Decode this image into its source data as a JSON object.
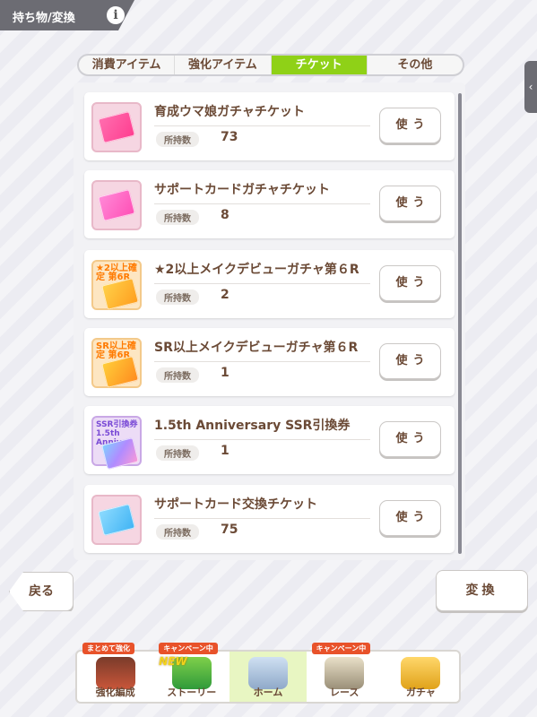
{
  "header": {
    "title": "持ち物/変換",
    "info_icon": "i"
  },
  "tabs": [
    {
      "label": "消費アイテム",
      "active": false
    },
    {
      "label": "強化アイテム",
      "active": false
    },
    {
      "label": "チケット",
      "active": true
    },
    {
      "label": "その他",
      "active": false
    }
  ],
  "side_handle": "‹",
  "items": [
    {
      "name": "育成ウマ娘ガチャチケット",
      "owned_label": "所持数",
      "owned": "73",
      "use_label": "使う",
      "icon": "pink-ticket-icon",
      "badge": ""
    },
    {
      "name": "サポートカードガチャチケット",
      "owned_label": "所持数",
      "owned": "8",
      "use_label": "使う",
      "icon": "pink-ticket-icon",
      "badge": ""
    },
    {
      "name": "★2以上メイクデビューガチャ第６R",
      "owned_label": "所持数",
      "owned": "2",
      "use_label": "使う",
      "icon": "orange-ticket-icon",
      "badge": "★2以上確定 第6R"
    },
    {
      "name": "SR以上メイクデビューガチャ第６R",
      "owned_label": "所持数",
      "owned": "1",
      "use_label": "使う",
      "icon": "orange-ticket-icon",
      "badge": "SR以上確定 第6R"
    },
    {
      "name": "1.5th Anniversary SSR引換券",
      "owned_label": "所持数",
      "owned": "1",
      "use_label": "使う",
      "icon": "rainbow-ticket-icon",
      "badge": "SSR引換券 1.5th Anniv."
    },
    {
      "name": "サポートカード交換チケット",
      "owned_label": "所持数",
      "owned": "75",
      "use_label": "使う",
      "icon": "blue-ticket-icon",
      "badge": ""
    }
  ],
  "buttons": {
    "back": "戻る",
    "exchange": "変換"
  },
  "nav": [
    {
      "label": "強化編成",
      "tag": "まとめて強化"
    },
    {
      "label": "ストーリー",
      "tag": "キャンペーン中",
      "new": "NEW"
    },
    {
      "label": "ホーム",
      "tag": ""
    },
    {
      "label": "レース",
      "tag": "キャンペーン中"
    },
    {
      "label": "ガチャ",
      "tag": ""
    }
  ],
  "colors": {
    "accent_tab": "#8fd117",
    "text_brown": "#6b4a36",
    "header_gray": "#6c6c73"
  }
}
